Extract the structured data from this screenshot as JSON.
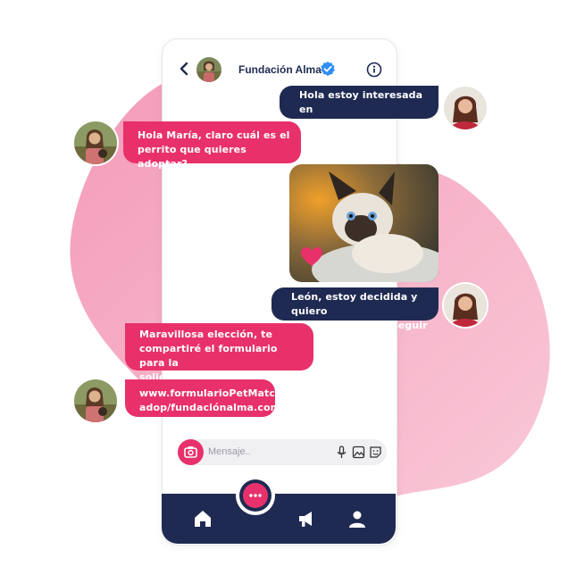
{
  "header": {
    "contact_name": "Fundación Alma",
    "verified": true
  },
  "messages": [
    {
      "from": "user",
      "text": "Hola estoy interesada en\nadoptar"
    },
    {
      "from": "contact",
      "text": "Hola María, claro cuál es el\nperrito que quieres adoptar?"
    },
    {
      "from": "user",
      "type": "image",
      "image": "kitten-photo",
      "reaction": "heart-icon"
    },
    {
      "from": "user",
      "text": "León, estoy decidida y quiero\nsaber los pasos a seguir"
    },
    {
      "from": "contact",
      "text": "Maravillosa elección,  te\ncompartiré el formulario para la\nsolicitud"
    },
    {
      "from": "contact",
      "text": "www.formularioPetMatch\nadop/fundaciónalma.com"
    }
  ],
  "composer": {
    "placeholder": "Mensaje.."
  },
  "nav": [
    "home-icon",
    "chat-icon",
    "megaphone-icon",
    "profile-icon"
  ],
  "colors": {
    "navy": "#1f2a52",
    "pink": "#e8316b",
    "blob": "#f4a5c0",
    "verified": "#2f8df5"
  }
}
